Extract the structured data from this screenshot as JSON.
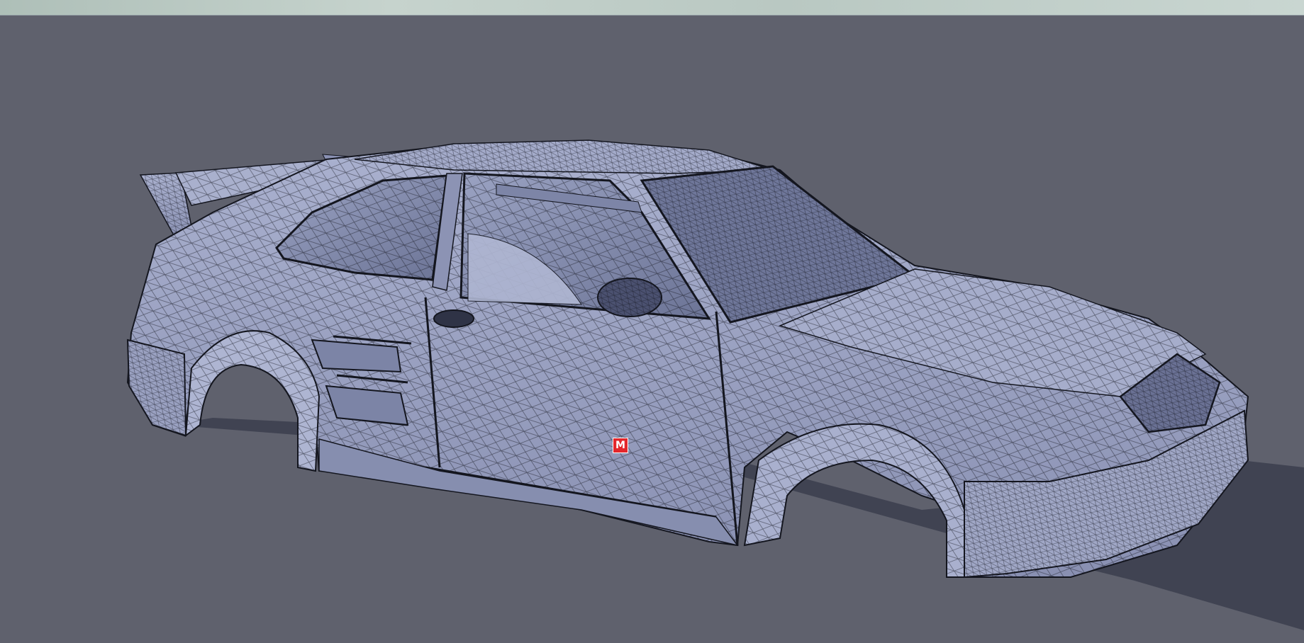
{
  "viewport": {
    "background_color": "#5f616d",
    "horizon_color": "#c2d0ca",
    "model_fill_color": "#9ea6c6",
    "model_shade_color": "#7d86a8",
    "wire_color": "#14161f",
    "shadow_color": "#3b3e4d"
  },
  "marker": {
    "label": "M",
    "color": "#e3262b",
    "icon": "marker-icon"
  }
}
